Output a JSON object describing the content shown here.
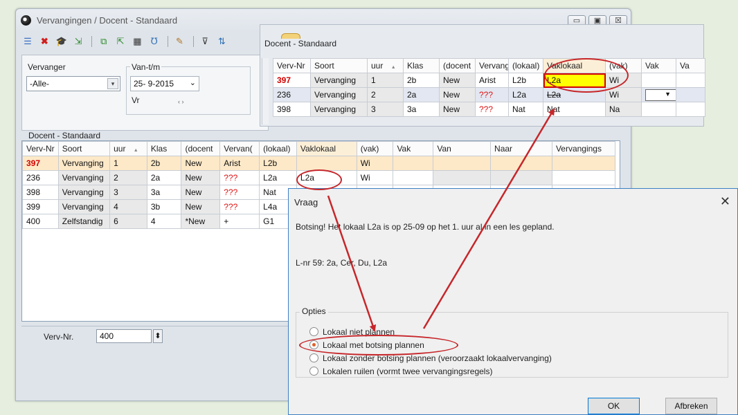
{
  "window": {
    "title": "Vervangingen / Docent - Standaard",
    "minimize": "▭",
    "restore": "▣",
    "close": "☒"
  },
  "toolbar": {
    "icons": [
      "list-icon",
      "delete-icon",
      "graduation-icon",
      "import-icon",
      "copy-icon",
      "export-icon",
      "calculator-icon",
      "stethoscope-icon",
      "wand-icon",
      "filter-icon",
      "sort-icon"
    ]
  },
  "filter": {
    "vervanger_label": "Vervanger",
    "vervanger_value": "-Alle-",
    "van_tm_label": "Van-t/m",
    "date_value": "25- 9-2015",
    "day_label": "Vr",
    "nav": "‹ ›"
  },
  "left": {
    "caption": "Docent - Standaard",
    "columns": [
      "Verv-Nr",
      "Soort",
      "uur",
      "Klas",
      "(docent",
      "Vervan(",
      "(lokaal)",
      "Vaklokaal",
      "(vak)",
      "Vak",
      "Van",
      "Naar",
      "Vervangings"
    ],
    "rows": [
      [
        "397",
        "Vervanging",
        "1",
        "2b",
        "New",
        "Arist",
        "L2b",
        "",
        "Wi",
        "",
        "",
        "",
        ""
      ],
      [
        "236",
        "Vervanging",
        "2",
        "2a",
        "New",
        "???",
        "L2a",
        "L2a",
        "Wi",
        "",
        "",
        "",
        ""
      ],
      [
        "398",
        "Vervanging",
        "3",
        "3a",
        "New",
        "???",
        "Nat",
        "",
        "",
        "",
        "",
        "",
        ""
      ],
      [
        "399",
        "Vervanging",
        "4",
        "3b",
        "New",
        "???",
        "L4a",
        "",
        "",
        "",
        "",
        "",
        ""
      ],
      [
        "400",
        "Zelfstandig",
        "6",
        "4",
        "*New",
        "+",
        "G1",
        "",
        "",
        "",
        "",
        "",
        ""
      ]
    ],
    "sort_glyph": "▲",
    "verv_nr_label": "Verv-Nr.",
    "verv_nr_value": "400",
    "spin": "⬍"
  },
  "right": {
    "caption": "Docent - Standaard",
    "columns": [
      "Verv-Nr",
      "Soort",
      "uur",
      "Klas",
      "(docent",
      "Vervang",
      "(lokaal)",
      "Vaklokaal",
      "(vak)",
      "Vak",
      "Va"
    ],
    "rows": [
      [
        "397",
        "Vervanging",
        "1",
        "2b",
        "New",
        "Arist",
        "L2b",
        "L2a",
        "Wi",
        "",
        ""
      ],
      [
        "236",
        "Vervanging",
        "2",
        "2a",
        "New",
        "???",
        "L2a",
        "L2a",
        "Wi",
        "",
        ""
      ],
      [
        "398",
        "Vervanging",
        "3",
        "3a",
        "New",
        "???",
        "Nat",
        "Nat",
        "Na",
        "",
        ""
      ]
    ]
  },
  "dialog": {
    "title": "Vraag",
    "close": "✕",
    "message": "Botsing! Het lokaal L2a is op 25-09 op het 1. uur al in een les gepland.",
    "lnr": "L-nr 59: 2a, Cer, Du, L2a",
    "options_legend": "Opties",
    "options": [
      "Lokaal niet plannen",
      "Lokaal met botsing plannen",
      "Lokaal zonder botsing plannen (veroorzaakt lokaalvervanging)",
      "Lokalen ruilen (vormt twee vervangingsregels)"
    ],
    "selected_option": 1,
    "ok_label": "OK",
    "cancel_label": "Afbreken"
  },
  "colors": {
    "annotation": "#c6262a",
    "highlight": "#ffff00",
    "dialog_border": "#3b7fc4"
  }
}
